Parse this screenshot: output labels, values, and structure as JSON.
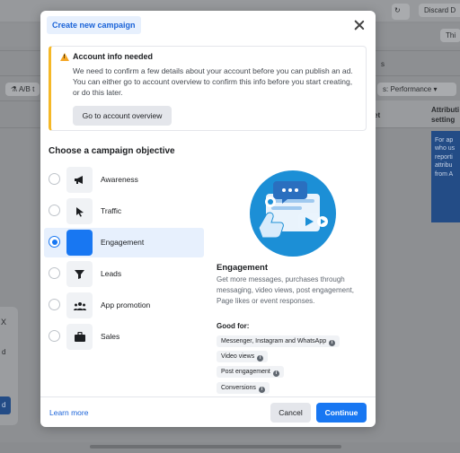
{
  "background": {
    "discard_label": "Discard D",
    "this_label": "Thi",
    "ab_test_label": "A/B t",
    "performance_label": "s: Performance",
    "table_header": [
      "Attributi",
      "setting"
    ],
    "net_label": "et",
    "tooltip_lines": [
      "For ap",
      "who us",
      "reporti",
      "attribu",
      "from A"
    ],
    "left_close": "X",
    "left_d": "d",
    "left_blue_label": "d",
    "s_label": "s"
  },
  "modal": {
    "header_tag": "Create new campaign",
    "alert": {
      "title": "Account info needed",
      "body": "We need to confirm a few details about your account before you can publish an ad. You can either go to account overview to confirm this info before you start creating, or do this later.",
      "button": "Go to account overview"
    },
    "section_title": "Choose a campaign objective",
    "objectives": [
      {
        "label": "Awareness",
        "icon": "megaphone-icon",
        "selected": false
      },
      {
        "label": "Traffic",
        "icon": "cursor-icon",
        "selected": false
      },
      {
        "label": "Engagement",
        "icon": "engagement-icon",
        "selected": true
      },
      {
        "label": "Leads",
        "icon": "funnel-icon",
        "selected": false
      },
      {
        "label": "App promotion",
        "icon": "people-icon",
        "selected": false
      },
      {
        "label": "Sales",
        "icon": "briefcase-icon",
        "selected": false
      }
    ],
    "detail": {
      "title": "Engagement",
      "description": "Get more messages, purchases through messaging, video views, post engagement, Page likes or event responses.",
      "good_for_label": "Good for:",
      "good_for": [
        "Messenger, Instagram and WhatsApp",
        "Video views",
        "Post engagement",
        "Conversions"
      ]
    },
    "footer": {
      "learn_more": "Learn more",
      "cancel": "Cancel",
      "continue": "Continue"
    }
  },
  "colors": {
    "accent": "#1877f2",
    "warning": "#f5b827",
    "illustration_circle": "#1c8fd6"
  }
}
